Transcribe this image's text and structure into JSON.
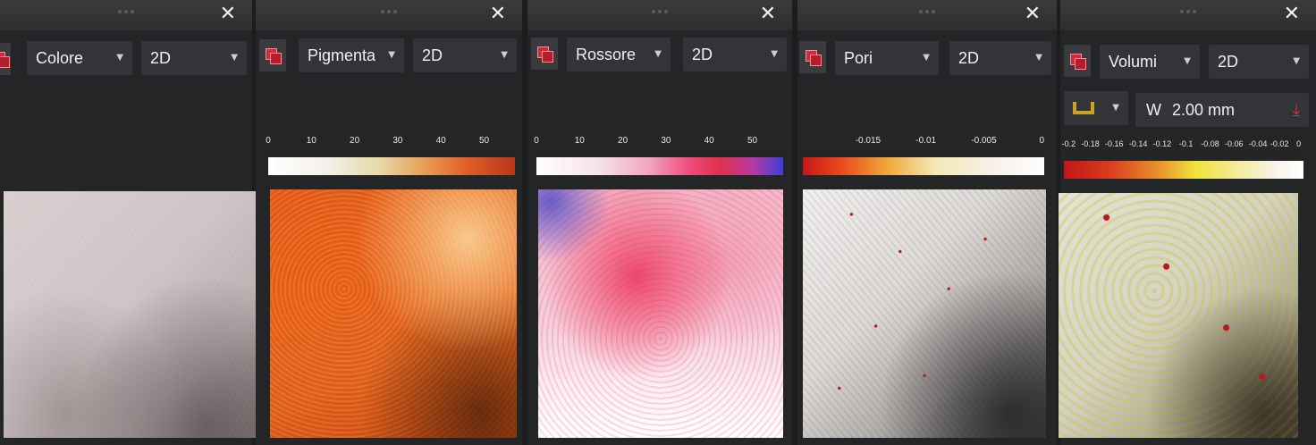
{
  "panels": [
    {
      "mode": "Colore",
      "view": "2D",
      "scale": []
    },
    {
      "mode": "Pigmenta",
      "view": "2D",
      "scale": [
        "0",
        "10",
        "20",
        "30",
        "40",
        "50"
      ]
    },
    {
      "mode": "Rossore",
      "view": "2D",
      "scale": [
        "0",
        "10",
        "20",
        "30",
        "40",
        "50"
      ]
    },
    {
      "mode": "Pori",
      "view": "2D",
      "scale": [
        "-0.015",
        "-0.01",
        "-0.005",
        "0"
      ]
    },
    {
      "mode": "Volumi",
      "view": "2D",
      "scale": [
        "-0.2",
        "-0.18",
        "-0.16",
        "-0.14",
        "-0.12",
        "-0.1",
        "-0.08",
        "-0.06",
        "-0.04",
        "-0.02",
        "0"
      ]
    }
  ],
  "volumi_tools": {
    "width_label": "W",
    "width_value": "2.00 mm"
  },
  "icons": {
    "close": "close-icon",
    "layers": "layers-icon",
    "caret": "chevron-down-icon",
    "measure": "measure-tool-icon",
    "pin": "pin-icon"
  },
  "colors": {
    "accent_red": "#d42a3c",
    "background": "#1c1d1f",
    "panel": "#242527",
    "measure_gold": "#c9a227"
  }
}
